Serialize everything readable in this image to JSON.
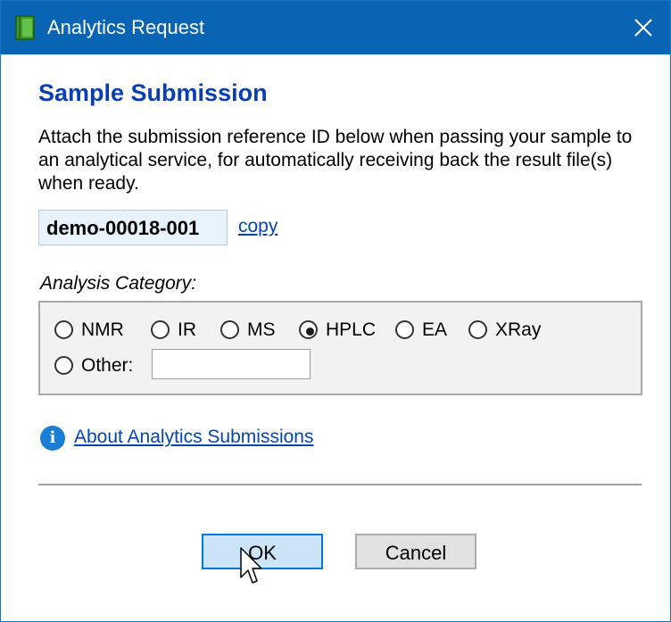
{
  "window": {
    "title": "Analytics Request",
    "icon": "book-icon",
    "close_icon": "close-icon"
  },
  "content": {
    "heading": "Sample Submission",
    "description": "Attach the submission reference ID below when passing your sample to an analytical service, for automatically receiving back the result file(s) when ready.",
    "reference_id": "demo-00018-001",
    "copy_label": "copy"
  },
  "analysis": {
    "label": "Analysis Category:",
    "options": [
      "NMR",
      "IR",
      "MS",
      "HPLC",
      "EA",
      "XRay"
    ],
    "selected": "HPLC",
    "other_label": "Other:",
    "other_value": ""
  },
  "info": {
    "icon": "info-icon",
    "link_label": "About Analytics Submissions"
  },
  "buttons": {
    "ok_label": "OK",
    "cancel_label": "Cancel"
  },
  "colors": {
    "titlebar": "#0a64b4",
    "heading": "#0a3fb4",
    "link": "#0645ad",
    "ok_button": "#cce4f7"
  }
}
